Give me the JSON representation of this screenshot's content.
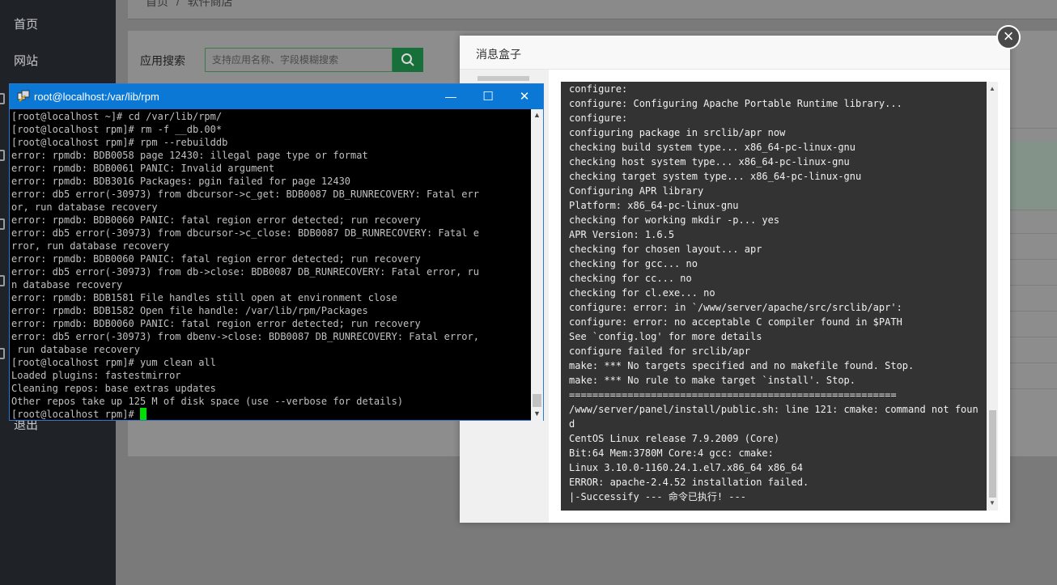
{
  "sidebar": {
    "items": [
      {
        "label": "首页"
      },
      {
        "label": "网站"
      },
      {
        "label": "退出"
      }
    ]
  },
  "breadcrumb": {
    "home": "首页",
    "separator": "/",
    "current": "软件商店"
  },
  "search": {
    "label": "应用搜索",
    "placeholder": "支持应用名称、字段模糊搜索"
  },
  "modal": {
    "title": "消息盒子",
    "close_symbol": "×",
    "log_lines": [
      "configure:",
      "configure: Configuring Apache Portable Runtime library...",
      "configure:",
      "configuring package in srclib/apr now",
      "checking build system type... x86_64-pc-linux-gnu",
      "checking host system type... x86_64-pc-linux-gnu",
      "checking target system type... x86_64-pc-linux-gnu",
      "Configuring APR library",
      "Platform: x86_64-pc-linux-gnu",
      "checking for working mkdir -p... yes",
      "APR Version: 1.6.5",
      "checking for chosen layout... apr",
      "checking for gcc... no",
      "checking for cc... no",
      "checking for cl.exe... no",
      "configure: error: in `/www/server/apache/src/srclib/apr':",
      "configure: error: no acceptable C compiler found in $PATH",
      "See `config.log' for more details",
      "configure failed for srclib/apr",
      "make: *** No targets specified and no makefile found. Stop.",
      "make: *** No rule to make target `install'. Stop.",
      "========================================================",
      "/www/server/panel/install/public.sh: line 121: cmake: command not foun",
      "d",
      "CentOS Linux release 7.9.2009 (Core)",
      "Bit:64 Mem:3780M Core:4 gcc: cmake:",
      "Linux 3.10.0-1160.24.1.el7.x86_64 x86_64",
      "ERROR: apache-2.4.52 installation failed.",
      "|-Successify --- 命令已执行! ---"
    ]
  },
  "terminal": {
    "title": "root@localhost:/var/lib/rpm",
    "min_symbol": "—",
    "max_symbol": "☐",
    "close_symbol": "✕",
    "prompt": "[root@localhost rpm]# ",
    "lines": [
      "[root@localhost ~]# cd /var/lib/rpm/",
      "[root@localhost rpm]# rm -f __db.00*",
      "[root@localhost rpm]# rpm --rebuilddb",
      "error: rpmdb: BDB0058 page 12430: illegal page type or format",
      "error: rpmdb: BDB0061 PANIC: Invalid argument",
      "error: rpmdb: BDB3016 Packages: pgin failed for page 12430",
      "error: db5 error(-30973) from dbcursor->c_get: BDB0087 DB_RUNRECOVERY: Fatal err",
      "or, run database recovery",
      "error: rpmdb: BDB0060 PANIC: fatal region error detected; run recovery",
      "error: db5 error(-30973) from dbcursor->c_close: BDB0087 DB_RUNRECOVERY: Fatal e",
      "rror, run database recovery",
      "error: rpmdb: BDB0060 PANIC: fatal region error detected; run recovery",
      "error: db5 error(-30973) from db->close: BDB0087 DB_RUNRECOVERY: Fatal error, ru",
      "n database recovery",
      "error: rpmdb: BDB1581 File handles still open at environment close",
      "error: rpmdb: BDB1582 Open file handle: /var/lib/rpm/Packages",
      "error: rpmdb: BDB0060 PANIC: fatal region error detected; run recovery",
      "error: db5 error(-30973) from dbenv->close: BDB0087 DB_RUNRECOVERY: Fatal error,",
      " run database recovery",
      "[root@localhost rpm]# yum clean all",
      "Loaded plugins: fastestmirror",
      "Cleaning repos: base extras updates",
      "Other repos take up 125 M of disk space (use --verbose for details)"
    ]
  }
}
